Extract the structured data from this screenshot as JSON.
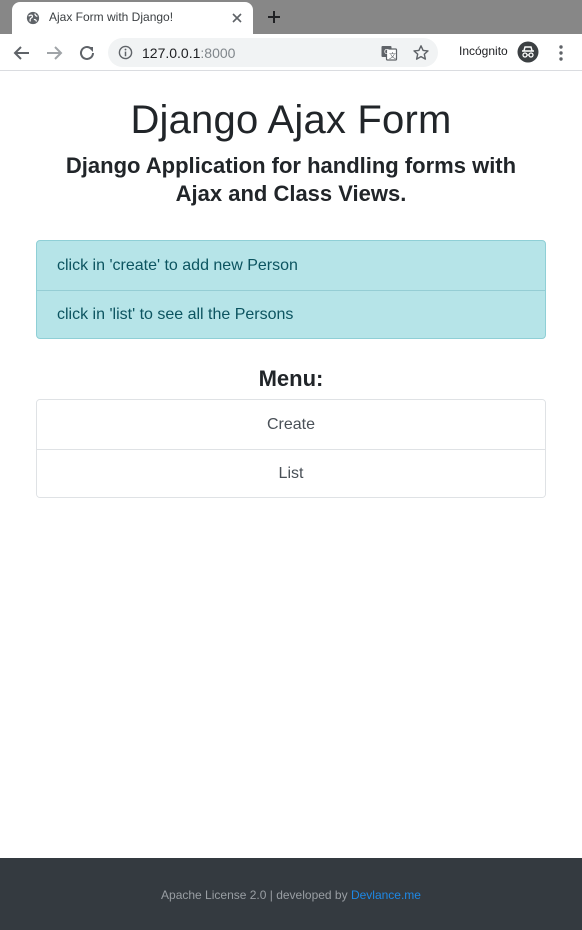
{
  "browser": {
    "tab_title": "Ajax Form with Django!",
    "url_host": "127.0.0.1",
    "url_port": ":8000",
    "incognito_label": "Incógnito"
  },
  "page": {
    "title": "Django Ajax Form",
    "subtitle": "Django Application for handling forms with Ajax and Class Views.",
    "alerts": [
      "click in 'create' to add new Person",
      "click in 'list' to see all the Persons"
    ],
    "menu_heading": "Menu:",
    "menu_items": [
      "Create",
      "List"
    ]
  },
  "footer": {
    "license_text": "Apache License 2.0 | developed by ",
    "link_text": "Devlance.me"
  },
  "colors": {
    "footer_bg": "#343a40",
    "alert_bg": "#b6e4e8",
    "link": "#1e88e5"
  },
  "icons": [
    "globe-icon",
    "close-icon",
    "plus-icon",
    "back-arrow-icon",
    "forward-arrow-icon",
    "reload-icon",
    "info-icon",
    "translate-icon",
    "star-icon",
    "incognito-icon",
    "more-vert-icon"
  ]
}
